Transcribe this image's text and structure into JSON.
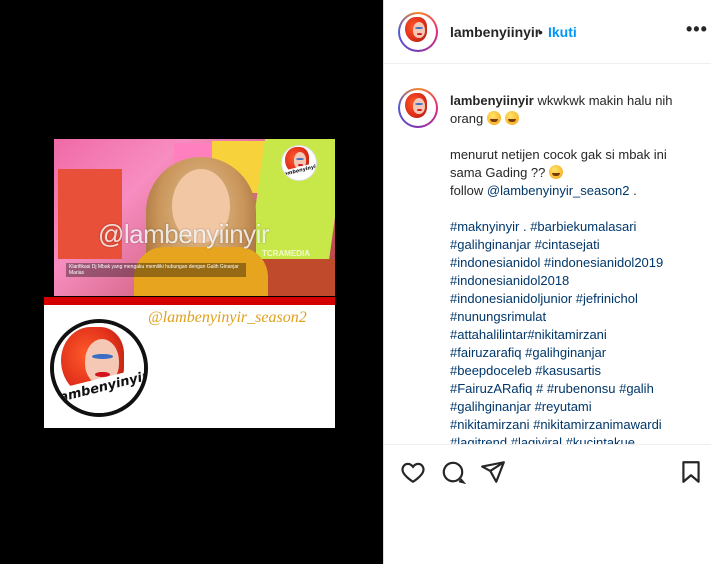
{
  "post": {
    "username": "lambenyiinyir",
    "separator": "•",
    "follow_label": "Ikuti",
    "more_label": "•••"
  },
  "media": {
    "watermark": "@lambenyiinyir",
    "source_mark": "TCRAMEDIA",
    "caption_text": "Klarifikasi Dj Mbak yang mengaku memiliki hubungan dengan Galih Ginanjar Marias",
    "promo_handle": "@lambenyinyir_season2",
    "avatar_text": "lambenyinyir"
  },
  "caption": {
    "username": "lambenyiinyir",
    "line1": "wkwkwk makin halu nih orang",
    "line2": "menurut netijen cocok gak si mbak ini sama Gading ??",
    "line3_prefix": "follow",
    "line3_mention": "@lambenyinyir_season2",
    "line3_suffix": ".",
    "hashtag_lines": [
      "#maknyinyir .  #barbiekumalasari",
      "#galihginanjar #cintasejati",
      "#indonesianidol #indonesianidol2019",
      "#indonesianidol2018",
      "#indonesianidoljunior #jefrinichol",
      "#nunungsrimulat",
      "#attahalilintar#nikitamirzani",
      "#fairuzarafiq #galihginanjar",
      "#beepdoceleb #kasusartis",
      "#FairuzARafiq #  #rubenonsu #galih",
      "#galihginanjar #reyutami",
      "#nikitamirzani #nikitamirzanimawardi",
      "#lagitrend #lagiviral #kucintakue"
    ]
  },
  "icons": {
    "like": "heart-icon",
    "comment": "comment-icon",
    "share": "share-icon",
    "save": "bookmark-icon"
  },
  "colors": {
    "link": "#0095f6",
    "hashtag": "#00376b",
    "promo_handle": "#e0a020",
    "bar": "#d40000"
  }
}
